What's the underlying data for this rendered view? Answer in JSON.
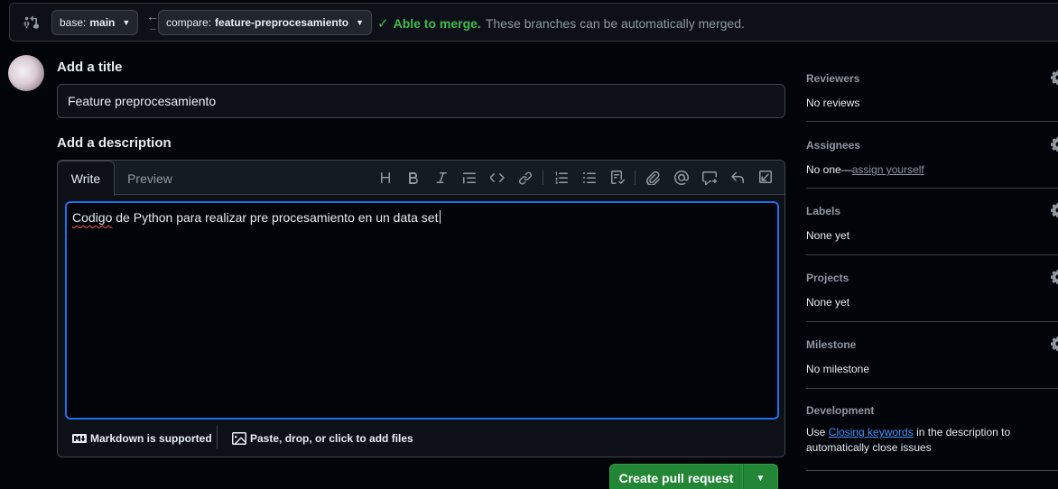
{
  "compare": {
    "base_label": "base:",
    "base_value": "main",
    "compare_label": "compare:",
    "compare_value": "feature-preprocesamiento",
    "merge_status": "Able to merge.",
    "merge_message": "These branches can be automatically merged."
  },
  "form": {
    "title_heading": "Add a title",
    "title_value": "Feature preprocesamiento",
    "description_heading": "Add a description",
    "description_value_word1": "Codigo",
    "description_value_rest": " de Python para realizar pre procesamiento en un data set",
    "tabs": [
      "Write",
      "Preview"
    ],
    "toolbar_icons": [
      "heading-icon",
      "bold-icon",
      "italic-icon",
      "quote-icon",
      "code-icon",
      "link-icon",
      "ordered-list-icon",
      "unordered-list-icon",
      "task-list-icon",
      "attach-icon",
      "mention-icon",
      "reference-icon",
      "undo-icon",
      "fullscreen-icon"
    ],
    "markdown_note": "Markdown is supported",
    "attach_note": "Paste, drop, or click to add files"
  },
  "actions": {
    "create_label": "Create pull request"
  },
  "sidebar": {
    "reviewers": {
      "heading": "Reviewers",
      "value": "No reviews"
    },
    "assignees": {
      "heading": "Assignees",
      "value_prefix": "No one—",
      "value_link": "assign yourself"
    },
    "labels": {
      "heading": "Labels",
      "value": "None yet"
    },
    "projects": {
      "heading": "Projects",
      "value": "None yet"
    },
    "milestone": {
      "heading": "Milestone",
      "value": "No milestone"
    },
    "development": {
      "heading": "Development",
      "value_prefix": "Use ",
      "value_link": "Closing keywords",
      "value_suffix": " in the description to automatically close issues"
    }
  },
  "colors": {
    "accent": "#1f6feb",
    "success": "#3fb950",
    "button_green": "#238636",
    "link": "#4493f8",
    "background": "#010409"
  }
}
